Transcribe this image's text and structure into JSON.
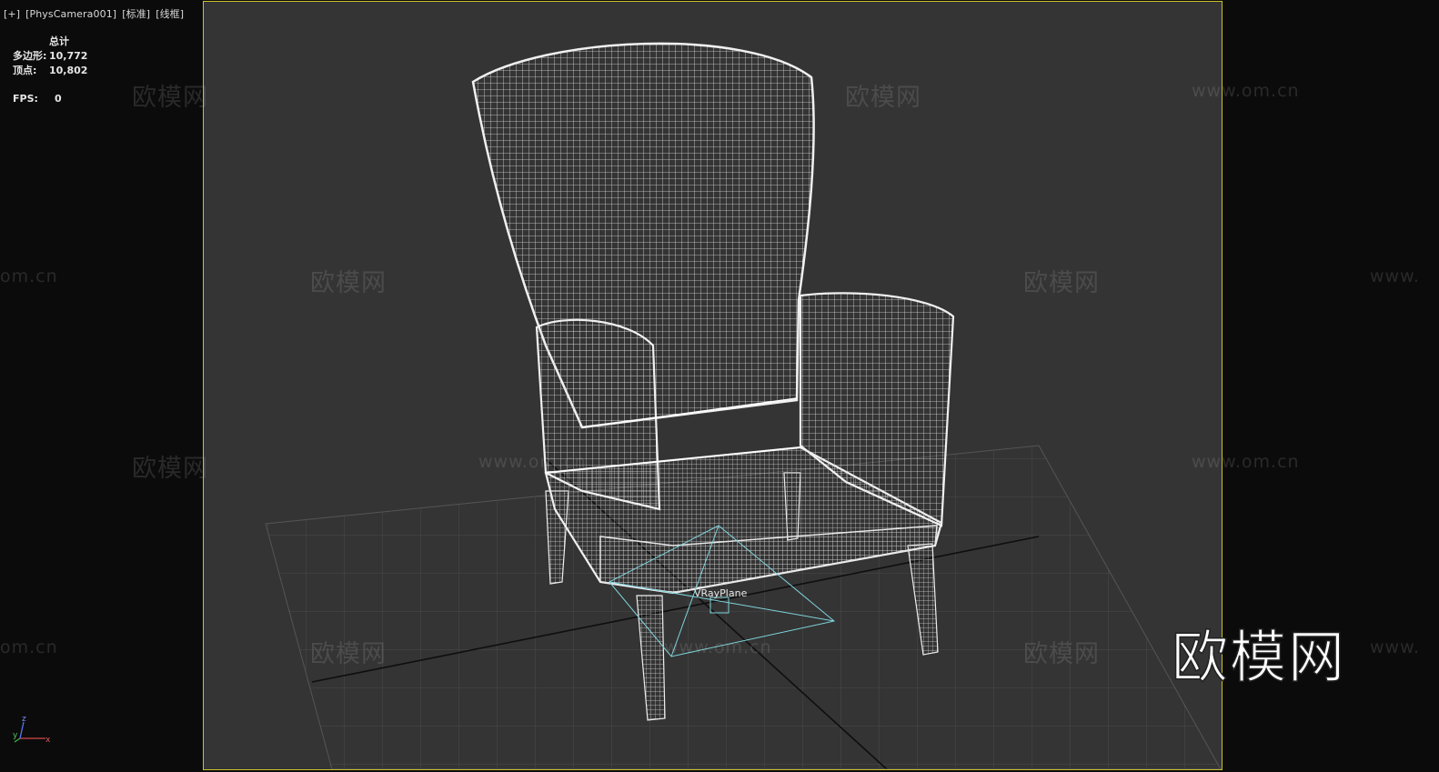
{
  "viewport_label": {
    "plus": "[+]",
    "camera": "[PhysCamera001]",
    "mode": "[标准]",
    "shading": "[线框]"
  },
  "stats": {
    "header": "总计",
    "polygons_label": "多边形:",
    "polygons_value": "10,772",
    "vertices_label": "顶点:",
    "vertices_value": "10,802",
    "fps_label": "FPS:",
    "fps_value": "0"
  },
  "object_label": "VRayPlane",
  "watermark": {
    "brand": "欧模网",
    "url": "www.om.cn",
    "url_partial": "om.cn",
    "url_partial_right": "www.",
    "big": "欧模网"
  },
  "axis": {
    "z": "z",
    "x": "x",
    "y": "y"
  },
  "colors": {
    "viewport_bg": "#343434",
    "active_border": "#c9c02a",
    "wireframe": "#e8e8e8",
    "grid": "#4a4a4a",
    "vrayplane": "#7fd3dc"
  }
}
